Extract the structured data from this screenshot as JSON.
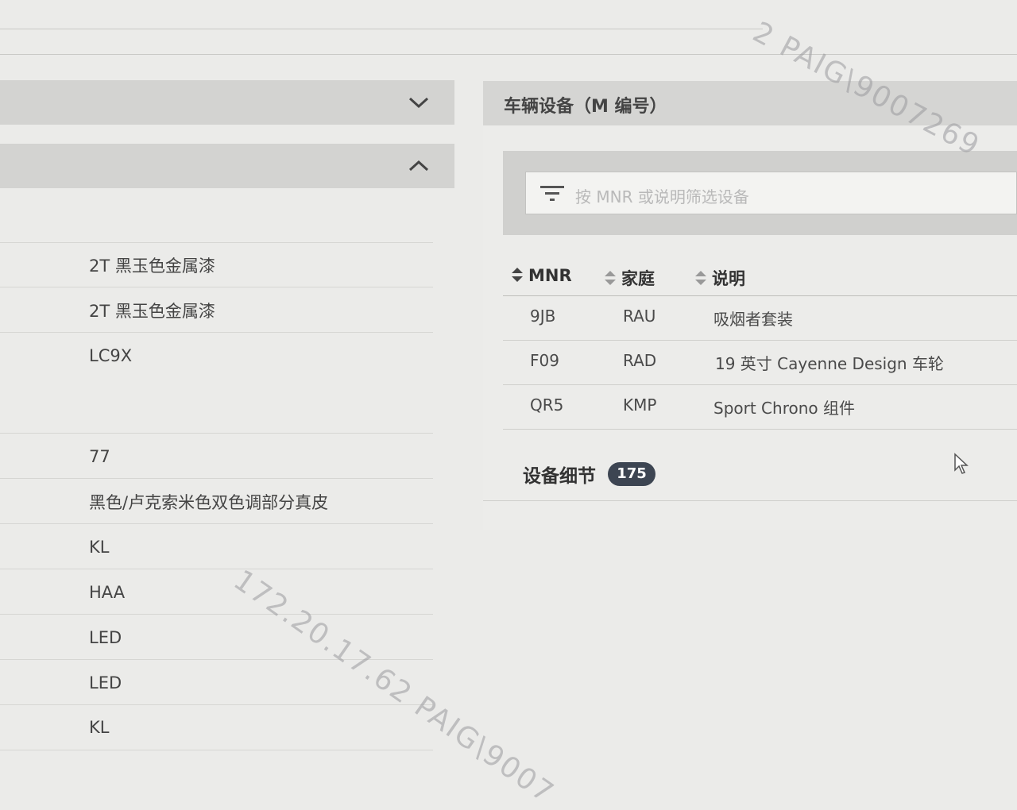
{
  "left_panel": {
    "collapsed_section_chevron": "chevron-down-icon",
    "expanded_section_chevron": "chevron-up-icon",
    "rows": [
      "2T 黑玉色金属漆",
      "2T 黑玉色金属漆",
      "LC9X",
      "77",
      "黑色/卢克索米色双色调部分真皮",
      "KL",
      "HAA",
      "LED",
      "LED",
      "KL"
    ]
  },
  "right_panel": {
    "title": "车辆设备（M 编号）",
    "filter": {
      "placeholder": "按 MNR 或说明筛选设备"
    },
    "table": {
      "headers": [
        "MNR",
        "家庭",
        "说明"
      ],
      "rows": [
        [
          "9JB",
          "RAU",
          "吸烟者套装"
        ],
        [
          "F09",
          "RAD",
          "19 英寸 Cayenne Design 车轮"
        ],
        [
          "QR5",
          "KMP",
          "Sport Chrono 组件"
        ]
      ]
    },
    "details_label": "设备细节",
    "details_count": "175"
  },
  "watermarks": [
    "2 PAIG\\9007269",
    "172.20.17.62  PAIG\\9007"
  ],
  "colors": {
    "background": "#ebebe9",
    "header_bar": "#d3d3d1",
    "badge": "#3d4552"
  }
}
